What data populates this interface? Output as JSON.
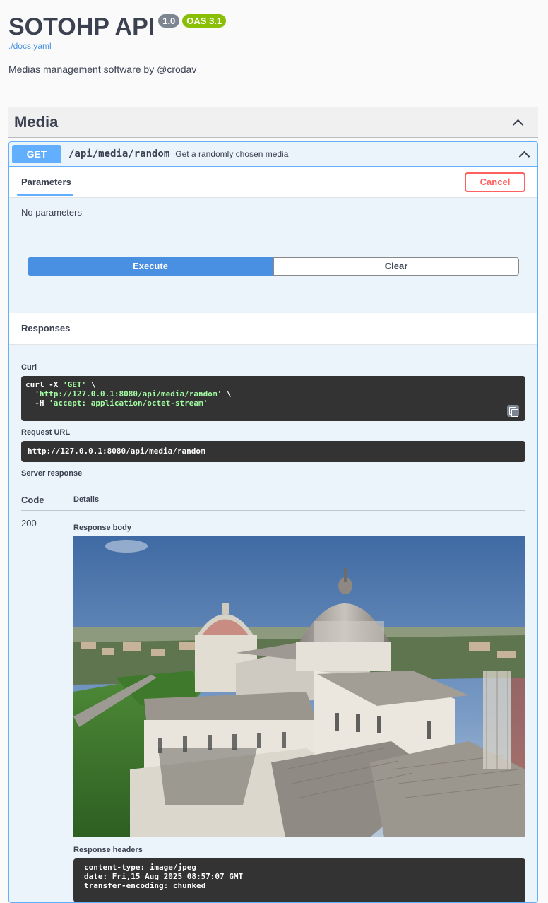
{
  "info": {
    "title": "SOTOHP API",
    "version": "1.0",
    "oas": "OAS 3.1",
    "docs_link": "./docs.yaml",
    "description": "Medias management software by @crodav"
  },
  "tag": {
    "name": "Media",
    "icon": "chevron-up-icon"
  },
  "operation": {
    "method": "GET",
    "path": "/api/media/random",
    "summary": "Get a randomly chosen media",
    "tabs": {
      "parameters": "Parameters"
    },
    "cancel_label": "Cancel",
    "no_params": "No parameters",
    "execute_label": "Execute",
    "clear_label": "Clear",
    "responses_label": "Responses",
    "curl_label": "Curl",
    "curl": {
      "line1_prefix": "curl -X ",
      "line1_method": "'GET'",
      "line1_suffix": " \\",
      "line2_url": "'http://127.0.0.1:8080/api/media/random'",
      "line2_suffix": " \\",
      "line3_prefix": "-H ",
      "line3_header": "'accept: application/octet-stream'"
    },
    "request_url_label": "Request URL",
    "request_url": "http://127.0.0.1:8080/api/media/random",
    "server_response_label": "Server response",
    "table": {
      "code_header": "Code",
      "details_header": "Details"
    },
    "response": {
      "code": "200",
      "body_label": "Response body",
      "headers_label": "Response headers",
      "headers": [
        "content-type: image/jpeg",
        "date: Fri,15 Aug 2025 08:57:07 GMT",
        "transfer-encoding: chunked"
      ]
    }
  },
  "colors": {
    "get": "#61affe",
    "execute": "#4990e2",
    "cancel": "#ff6060",
    "oas_badge": "#89bf04",
    "version_badge": "#7d8492"
  }
}
